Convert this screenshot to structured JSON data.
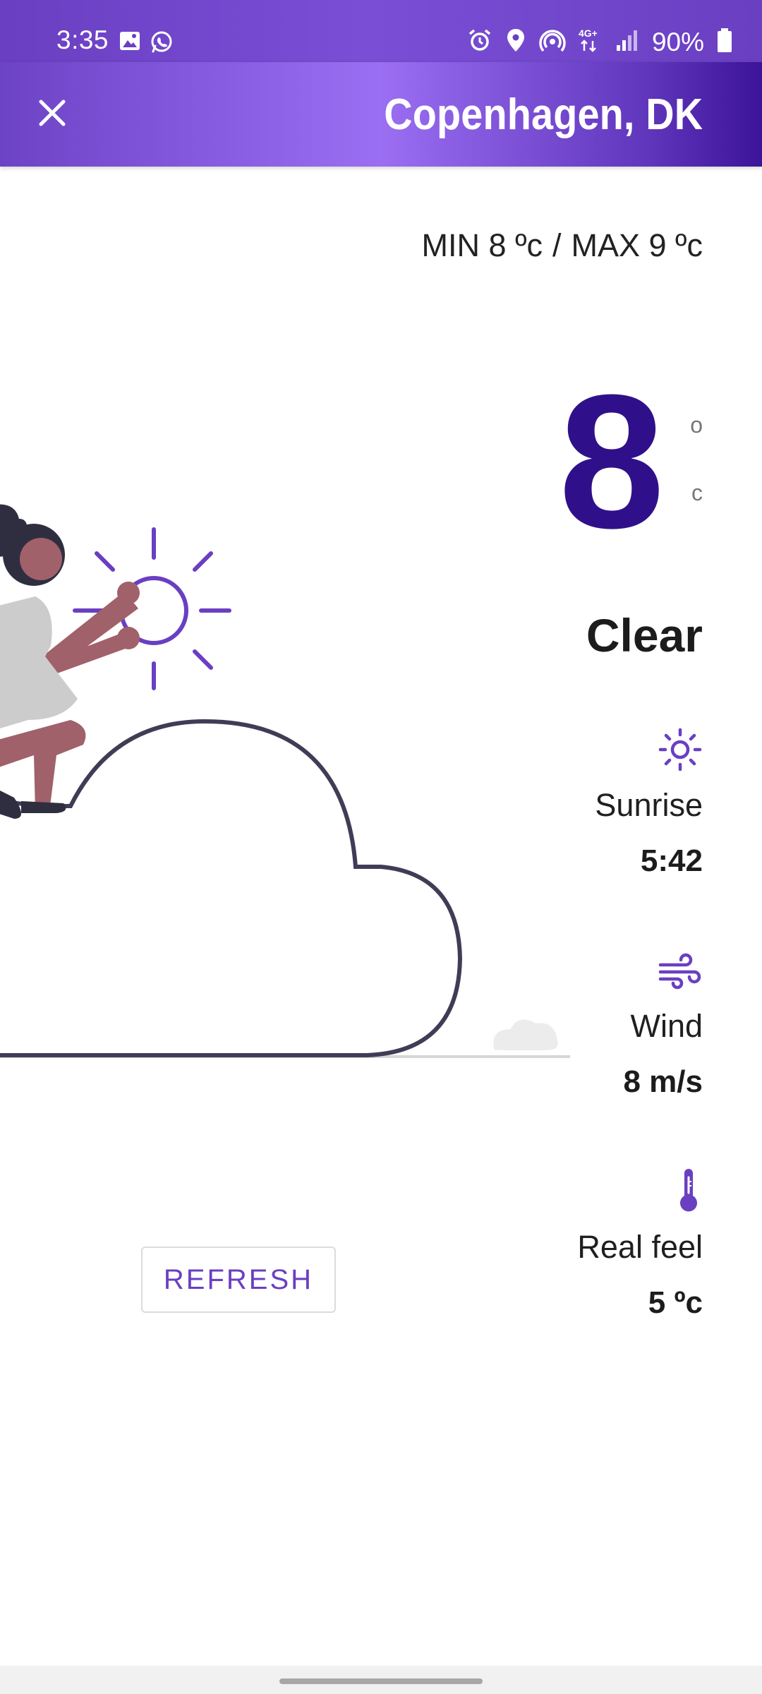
{
  "status_bar": {
    "time": "3:35",
    "battery": "90%",
    "network": "4G+",
    "icons_left": [
      "gallery-icon",
      "whatsapp-icon"
    ],
    "icons_right": [
      "alarm-icon",
      "location-icon",
      "hotspot-icon",
      "signal-icon",
      "battery-icon"
    ]
  },
  "app_bar": {
    "title": "Copenhagen, DK",
    "close_icon": "close-icon"
  },
  "weather": {
    "min_text": "MIN 8 ºc",
    "separator": "/",
    "max_text": "MAX 9 ºc",
    "temperature": "8",
    "unit_degree": "o",
    "unit_c": "c",
    "condition": "Clear"
  },
  "details": {
    "sunrise": {
      "label": "Sunrise",
      "value": "5:42",
      "icon": "sun-icon"
    },
    "wind": {
      "label": "Wind",
      "value": "8 m/s",
      "icon": "wind-icon"
    },
    "real_feel": {
      "label": "Real feel",
      "value": "5 ºc",
      "icon": "thermometer-icon"
    }
  },
  "actions": {
    "refresh_label": "REFRESH"
  },
  "colors": {
    "primary": "#6a3fc1",
    "primary_dark": "#30108a",
    "accent": "#7b4fd6"
  }
}
